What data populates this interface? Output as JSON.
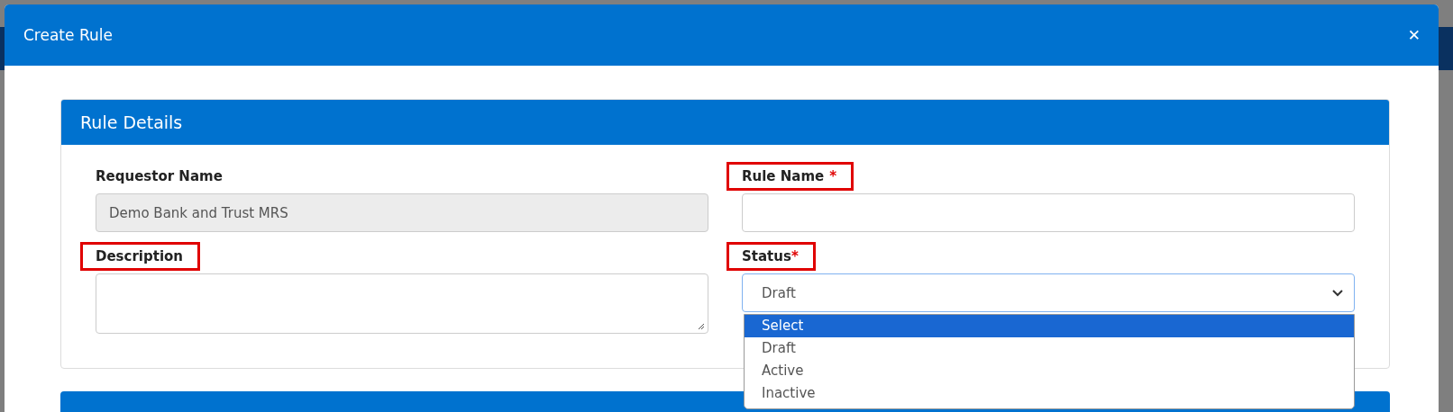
{
  "dialog": {
    "title": "Create Rule",
    "close_icon": "✕"
  },
  "section": {
    "title": "Rule Details",
    "fields": [
      {
        "kind": "input",
        "label": "Requestor Name",
        "highlighted": false,
        "value": "Demo Bank and Trust MRS",
        "disabled": true
      },
      {
        "kind": "input",
        "label": "Rule Name",
        "required_mark": "*",
        "highlighted": true
      },
      {
        "kind": "textarea",
        "label": "Description",
        "highlighted": true
      },
      {
        "kind": "select",
        "label": "Status",
        "required_mark": "*",
        "highlighted": true,
        "value": "Draft",
        "expanded": true,
        "options": [
          {
            "label": "Select",
            "highlighted": true
          },
          {
            "label": "Draft",
            "highlighted": false
          },
          {
            "label": "Active",
            "highlighted": false
          },
          {
            "label": "Inactive",
            "highlighted": false
          }
        ]
      }
    ]
  },
  "next_section": {
    "kind": "card"
  }
}
